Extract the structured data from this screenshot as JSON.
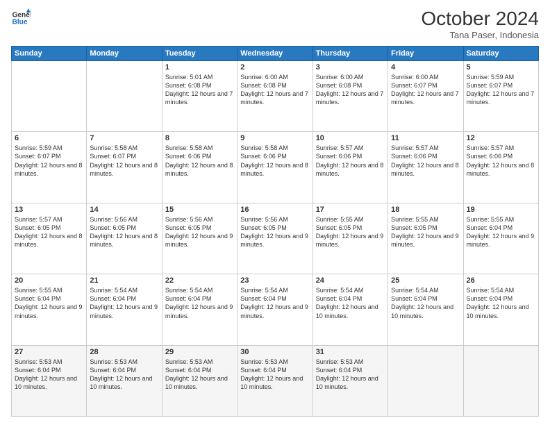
{
  "logo": {
    "line1": "General",
    "line2": "Blue"
  },
  "header": {
    "month": "October 2024",
    "location": "Tana Paser, Indonesia"
  },
  "weekdays": [
    "Sunday",
    "Monday",
    "Tuesday",
    "Wednesday",
    "Thursday",
    "Friday",
    "Saturday"
  ],
  "weeks": [
    [
      null,
      null,
      {
        "day": 1,
        "sunrise": "5:01 AM",
        "sunset": "6:08 PM",
        "daylight": "12 hours and 7 minutes."
      },
      {
        "day": 2,
        "sunrise": "6:00 AM",
        "sunset": "6:08 PM",
        "daylight": "12 hours and 7 minutes."
      },
      {
        "day": 3,
        "sunrise": "6:00 AM",
        "sunset": "6:08 PM",
        "daylight": "12 hours and 7 minutes."
      },
      {
        "day": 4,
        "sunrise": "6:00 AM",
        "sunset": "6:07 PM",
        "daylight": "12 hours and 7 minutes."
      },
      {
        "day": 5,
        "sunrise": "5:59 AM",
        "sunset": "6:07 PM",
        "daylight": "12 hours and 7 minutes."
      }
    ],
    [
      {
        "day": 6,
        "sunrise": "5:59 AM",
        "sunset": "6:07 PM",
        "daylight": "12 hours and 8 minutes."
      },
      {
        "day": 7,
        "sunrise": "5:58 AM",
        "sunset": "6:07 PM",
        "daylight": "12 hours and 8 minutes."
      },
      {
        "day": 8,
        "sunrise": "5:58 AM",
        "sunset": "6:06 PM",
        "daylight": "12 hours and 8 minutes."
      },
      {
        "day": 9,
        "sunrise": "5:58 AM",
        "sunset": "6:06 PM",
        "daylight": "12 hours and 8 minutes."
      },
      {
        "day": 10,
        "sunrise": "5:57 AM",
        "sunset": "6:06 PM",
        "daylight": "12 hours and 8 minutes."
      },
      {
        "day": 11,
        "sunrise": "5:57 AM",
        "sunset": "6:06 PM",
        "daylight": "12 hours and 8 minutes."
      },
      {
        "day": 12,
        "sunrise": "5:57 AM",
        "sunset": "6:06 PM",
        "daylight": "12 hours and 8 minutes."
      }
    ],
    [
      {
        "day": 13,
        "sunrise": "5:57 AM",
        "sunset": "6:05 PM",
        "daylight": "12 hours and 8 minutes."
      },
      {
        "day": 14,
        "sunrise": "5:56 AM",
        "sunset": "6:05 PM",
        "daylight": "12 hours and 8 minutes."
      },
      {
        "day": 15,
        "sunrise": "5:56 AM",
        "sunset": "6:05 PM",
        "daylight": "12 hours and 9 minutes."
      },
      {
        "day": 16,
        "sunrise": "5:56 AM",
        "sunset": "6:05 PM",
        "daylight": "12 hours and 9 minutes."
      },
      {
        "day": 17,
        "sunrise": "5:55 AM",
        "sunset": "6:05 PM",
        "daylight": "12 hours and 9 minutes."
      },
      {
        "day": 18,
        "sunrise": "5:55 AM",
        "sunset": "6:05 PM",
        "daylight": "12 hours and 9 minutes."
      },
      {
        "day": 19,
        "sunrise": "5:55 AM",
        "sunset": "6:04 PM",
        "daylight": "12 hours and 9 minutes."
      }
    ],
    [
      {
        "day": 20,
        "sunrise": "5:55 AM",
        "sunset": "6:04 PM",
        "daylight": "12 hours and 9 minutes."
      },
      {
        "day": 21,
        "sunrise": "5:54 AM",
        "sunset": "6:04 PM",
        "daylight": "12 hours and 9 minutes."
      },
      {
        "day": 22,
        "sunrise": "5:54 AM",
        "sunset": "6:04 PM",
        "daylight": "12 hours and 9 minutes."
      },
      {
        "day": 23,
        "sunrise": "5:54 AM",
        "sunset": "6:04 PM",
        "daylight": "12 hours and 9 minutes."
      },
      {
        "day": 24,
        "sunrise": "5:54 AM",
        "sunset": "6:04 PM",
        "daylight": "12 hours and 10 minutes."
      },
      {
        "day": 25,
        "sunrise": "5:54 AM",
        "sunset": "6:04 PM",
        "daylight": "12 hours and 10 minutes."
      },
      {
        "day": 26,
        "sunrise": "5:54 AM",
        "sunset": "6:04 PM",
        "daylight": "12 hours and 10 minutes."
      }
    ],
    [
      {
        "day": 27,
        "sunrise": "5:53 AM",
        "sunset": "6:04 PM",
        "daylight": "12 hours and 10 minutes."
      },
      {
        "day": 28,
        "sunrise": "5:53 AM",
        "sunset": "6:04 PM",
        "daylight": "12 hours and 10 minutes."
      },
      {
        "day": 29,
        "sunrise": "5:53 AM",
        "sunset": "6:04 PM",
        "daylight": "12 hours and 10 minutes."
      },
      {
        "day": 30,
        "sunrise": "5:53 AM",
        "sunset": "6:04 PM",
        "daylight": "12 hours and 10 minutes."
      },
      {
        "day": 31,
        "sunrise": "5:53 AM",
        "sunset": "6:04 PM",
        "daylight": "12 hours and 10 minutes."
      },
      null,
      null
    ]
  ]
}
